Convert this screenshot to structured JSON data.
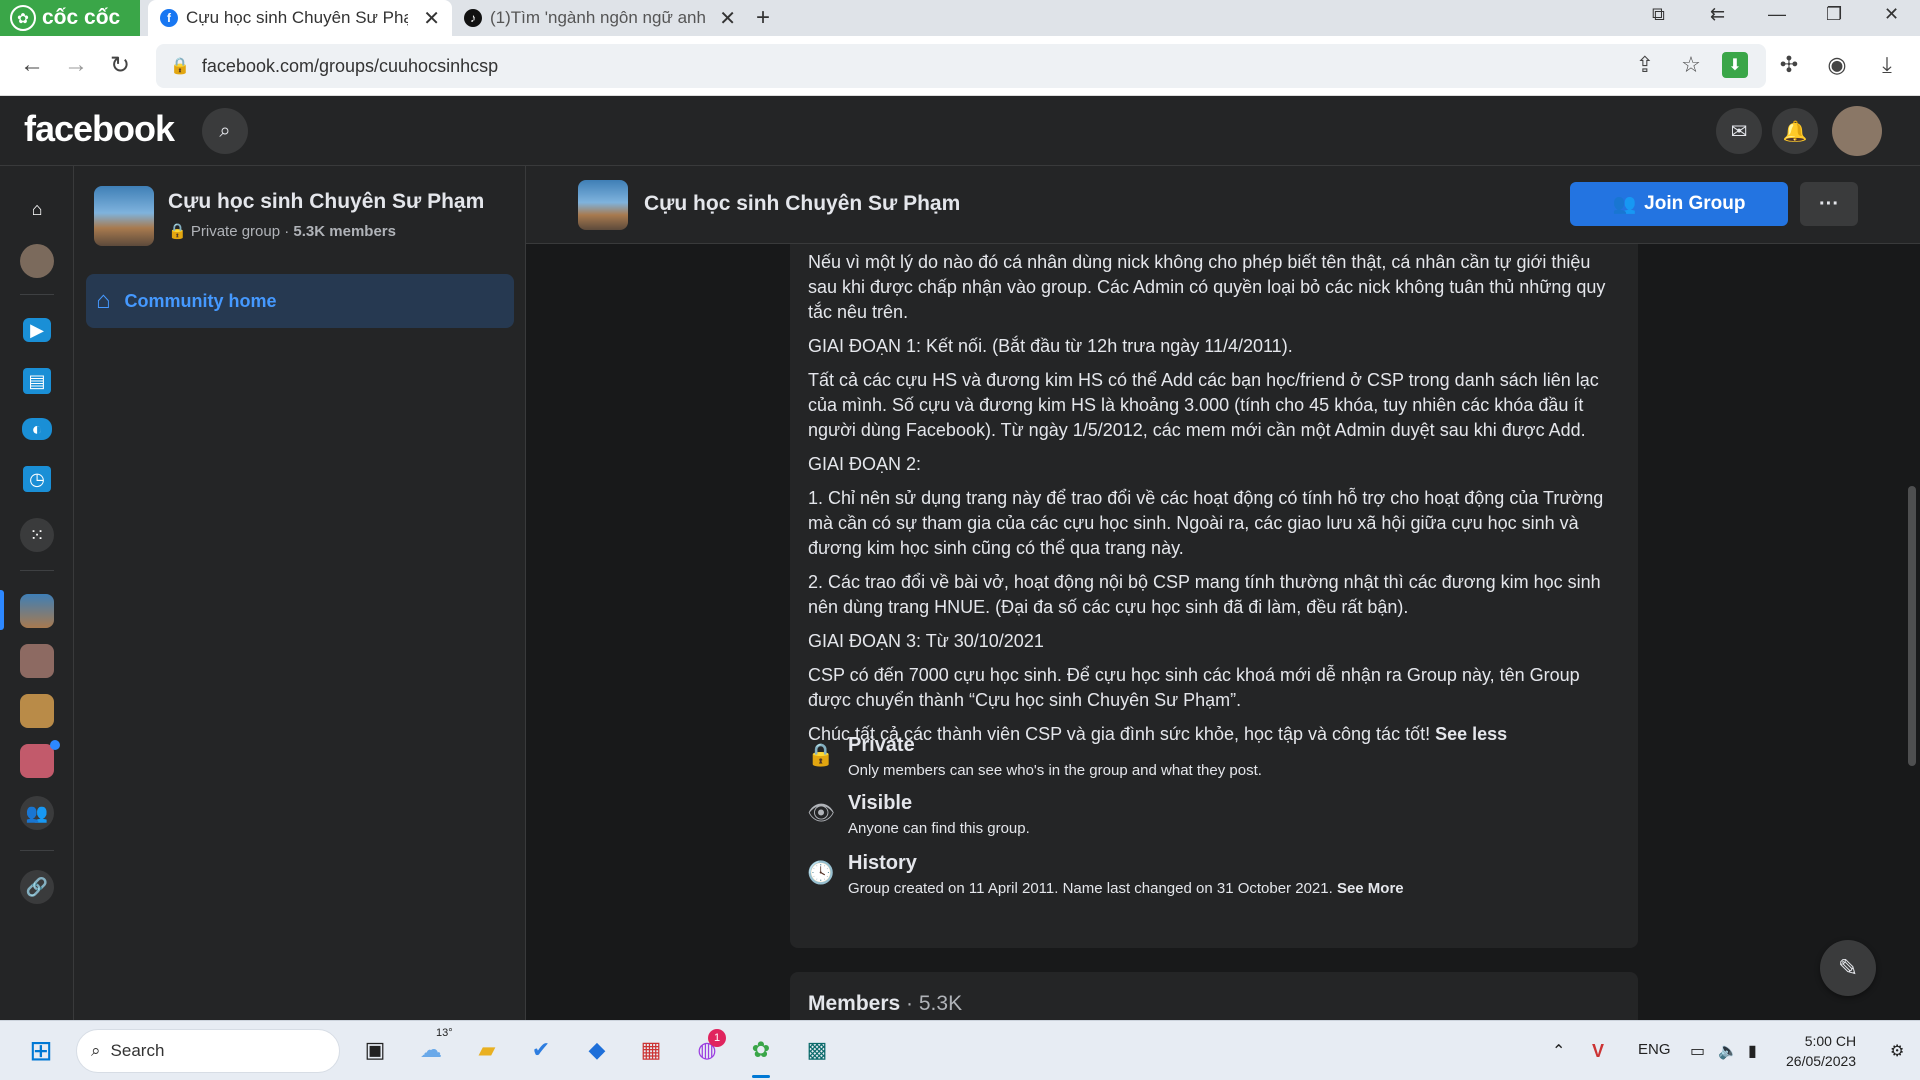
{
  "browser": {
    "brand": "cốc cốc",
    "tabs": [
      {
        "title": "Cựu học sinh Chuyên Sư Phạm",
        "favicon": "facebook-icon"
      },
      {
        "title": "(1)Tìm 'ngành ngôn ngữ anh",
        "favicon": "tiktok-icon"
      }
    ],
    "url": "facebook.com/groups/cuuhocsinhcsp"
  },
  "fb": {
    "logo": "facebook"
  },
  "group": {
    "name": "Cựu học sinh Chuyên Sư Phạm",
    "privacy": "Private group",
    "members_short": "5.3K members",
    "sidebar_item": "Community home",
    "join_label": "Join Group",
    "more_label": "···"
  },
  "about": {
    "paragraphs": [
      "Nếu vì một lý do nào đó cá nhân dùng nick không cho phép biết tên thật, cá nhân cần tự giới thiệu sau khi được chấp nhận vào group. Các Admin có quyền loại bỏ các nick không tuân thủ những quy tắc nêu trên.",
      "GIAI ĐOẠN 1: Kết nối. (Bắt đầu từ 12h trưa ngày 11/4/2011).",
      "Tất cả các cựu HS và đương kim HS có thể Add các bạn học/friend ở CSP trong danh sách liên lạc của mình. Số cựu và đương kim HS là khoảng 3.000 (tính cho 45 khóa, tuy nhiên các khóa đầu ít người dùng Facebook). Từ ngày 1/5/2012, các mem mới cần một Admin duyệt sau khi được Add.",
      "GIAI ĐOẠN 2:",
      "1. Chỉ nên sử dụng trang này để trao đổi về các hoạt động có tính hỗ trợ cho hoạt động của Trường mà cần có sự tham gia của các cựu học sinh. Ngoài ra, các giao lưu xã hội giữa cựu học sinh và đương kim học sinh cũng có thể qua trang này.",
      "2. Các trao đổi về bài vở, hoạt động nội bộ CSP mang tính thường nhật thì các đương kim học sinh nên dùng trang HNUE. (Đại đa số các cựu học sinh đã đi làm, đều rất bận).",
      "GIAI ĐOẠN 3: Từ 30/10/2021",
      "CSP có đến 7000 cựu học sinh. Để cựu học sinh các khoá mới dễ nhận ra Group này, tên Group được chuyển thành “Cựu học sinh Chuyên Sư Phạm”."
    ],
    "closing": "Chúc tất cả các thành viên CSP và gia đình sức khỏe, học tập và công tác tốt!",
    "see_less": "See less",
    "private_title": "Private",
    "private_desc": "Only members can see who's in the group and what they post.",
    "visible_title": "Visible",
    "visible_desc": "Anyone can find this group.",
    "history_title": "History",
    "history_desc": "Group created on 11 April 2011. Name last changed on 31 October 2021.",
    "see_more": "See More"
  },
  "members_card": {
    "title": "Members",
    "sep": " · ",
    "count": "5.3K"
  },
  "taskbar": {
    "search": "Search",
    "weather": "13°",
    "messenger_badge": "1",
    "lang": "ENG",
    "time": "5:00 CH",
    "date": "26/05/2023"
  },
  "colors": {
    "fb_blue": "#2374e1",
    "accent_link": "#4599ff",
    "coccoc_green": "#3aa648"
  }
}
